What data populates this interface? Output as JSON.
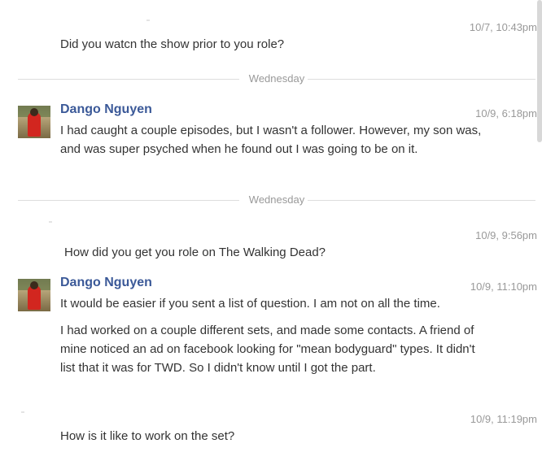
{
  "messages": [
    {
      "sender": "",
      "time": "10/7, 10:43pm",
      "text": [
        "Did you watcn the show prior to you role?"
      ]
    },
    {
      "sender": "Dango Nguyen",
      "time": "10/9, 6:18pm",
      "text": [
        "I had caught a couple episodes, but I wasn't a follower.  However, my son was, and was super psyched when he found out I was going to be on it."
      ]
    },
    {
      "sender": "",
      "time": "10/9, 9:56pm",
      "text": [
        "How did you get you role on The Walking Dead?"
      ]
    },
    {
      "sender": "Dango Nguyen",
      "time": "10/9, 11:10pm",
      "text": [
        "It would be easier if you sent a list of question.  I am not on all the time.",
        "I had worked on a couple different sets, and made some contacts.  A friend of mine noticed an ad on facebook looking for \"mean bodyguard\" types.  It didn't list that it was for TWD.  So I didn't know until I got the part."
      ]
    },
    {
      "sender": "",
      "time": "10/9, 11:19pm",
      "text": [
        "How is it like to work on the set?"
      ]
    }
  ],
  "separators": [
    "Wednesday",
    "Wednesday"
  ],
  "colors": {
    "name": "#3b5998",
    "time": "#999999",
    "text": "#333333",
    "divider": "#dddddd"
  },
  "icons": {
    "avatar": "profile-photo-avatar"
  }
}
